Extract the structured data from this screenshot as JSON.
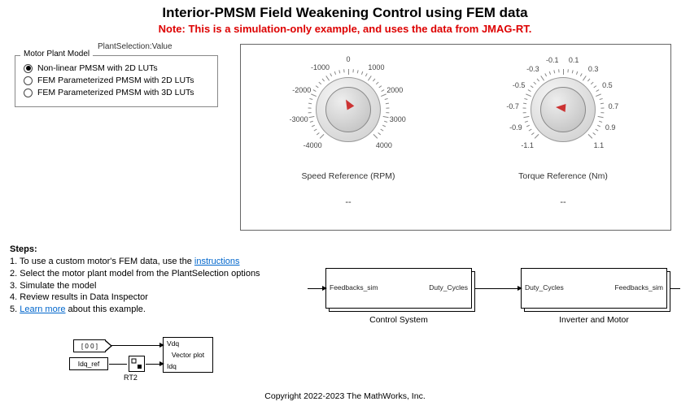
{
  "title": "Interior-PMSM Field Weakening Control using FEM data",
  "note": "Note: This is a simulation-only example, and uses the data from JMAG-RT.",
  "param_label": "PlantSelection:Value",
  "radio": {
    "legend": "Motor Plant Model",
    "options": [
      {
        "label": "Non-linear PMSM with 2D LUTs",
        "selected": true
      },
      {
        "label": "FEM Parameterized PMSM with 2D LUTs",
        "selected": false
      },
      {
        "label": "FEM Parameterized PMSM with 3D LUTs",
        "selected": false
      }
    ]
  },
  "dials": {
    "speed": {
      "title": "Speed Reference (RPM)",
      "value": "--",
      "ticks": [
        "-4000",
        "-3000",
        "-2000",
        "-1000",
        "0",
        "1000",
        "2000",
        "3000",
        "4000"
      ],
      "pointer_deg": 150
    },
    "torque": {
      "title": "Torque Reference (Nm)",
      "value": "--",
      "ticks": [
        "-1.1",
        "-0.9",
        "-0.7",
        "-0.5",
        "-0.3",
        "-0.1",
        "0.1",
        "0.3",
        "0.5",
        "0.7",
        "0.9",
        "1.1"
      ],
      "pointer_deg": 95
    }
  },
  "steps": {
    "heading": "Steps:",
    "s1a": "1. To use a custom motor's FEM data, use the ",
    "s1link": "instructions",
    "s2": "2. Select the motor plant model from the PlantSelection options",
    "s3": "3. Simulate the model",
    "s4": "4. Review results in Data Inspector",
    "s5a": "5. ",
    "s5link": "Learn more",
    "s5b": " about this example."
  },
  "blocks": {
    "control": {
      "name": "Control System",
      "port_left": "Feedbacks_sim",
      "port_right": "Duty_Cycles"
    },
    "inverter": {
      "name": "Inverter and Motor",
      "port_left": "Duty_Cycles",
      "port_right": "Feedbacks_sim"
    },
    "const_block": "[ 0  0 ]",
    "idq_ref": "Idq_ref",
    "rt2": "RT2",
    "vdq": "Vdq",
    "vector_plot": "Vector plot",
    "idq": "Idq"
  },
  "copyright": "Copyright 2022-2023 The MathWorks, Inc."
}
